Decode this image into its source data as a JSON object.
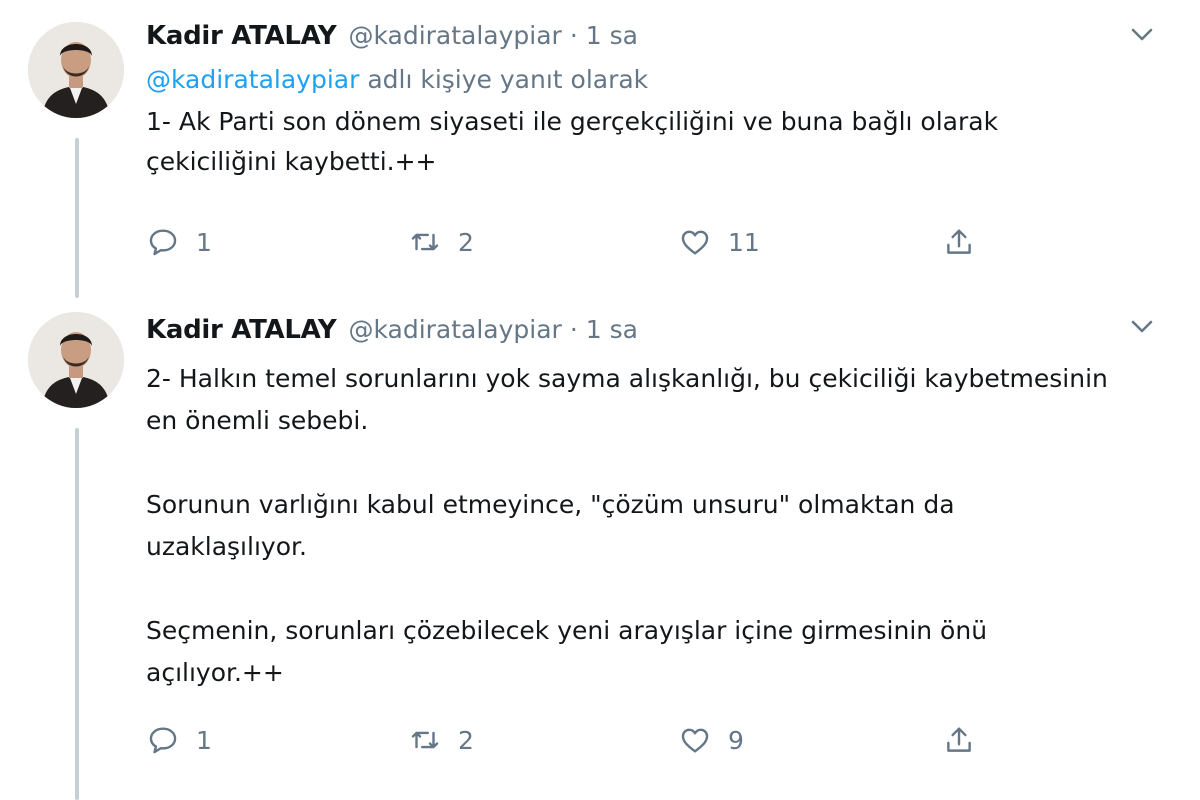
{
  "tweets": [
    {
      "name": "Kadir ATALAY",
      "handle": "@kadiratalaypiar",
      "dot": "·",
      "time": "1 sa",
      "reply_mention": "@kadiratalaypiar",
      "reply_text": " adlı kişiye yanıt olarak",
      "text": "1- Ak Parti son dönem siyaseti ile gerçekçiliğini ve buna bağlı olarak\nçekiciliğini kaybetti.++",
      "replies": "1",
      "retweets": "2",
      "likes": "11"
    },
    {
      "name": "Kadir ATALAY",
      "handle": "@kadiratalaypiar",
      "dot": "·",
      "time": "1 sa",
      "text": "2- Halkın temel sorunlarını yok sayma alışkanlığı, bu çekiciliği kaybetmesinin\nen önemli sebebi.\n\nSorunun varlığını kabul etmeyince, \"çözüm unsuru\" olmaktan da\nuzaklaşılıyor.\n\nSeçmenin, sorunları çözebilecek yeni arayışlar içine girmesinin önü\naçılıyor.++",
      "replies": "1",
      "retweets": "2",
      "likes": "9"
    }
  ],
  "colors": {
    "link": "#1da1f2",
    "muted": "#657786",
    "thread_line": "#c4cfd6"
  }
}
